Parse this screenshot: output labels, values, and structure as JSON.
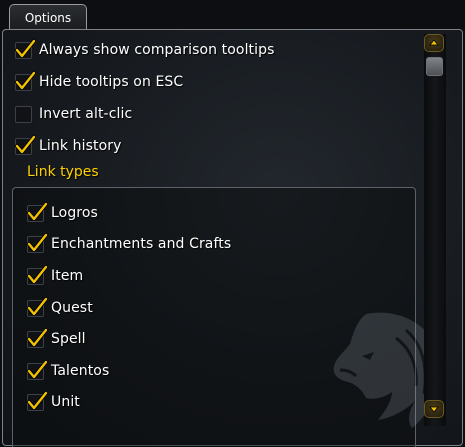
{
  "tab": {
    "label": "Options"
  },
  "options": [
    {
      "label": "Always show comparison tooltips",
      "checked": true
    },
    {
      "label": "Hide tooltips on ESC",
      "checked": true
    },
    {
      "label": "Invert alt-clic",
      "checked": false
    },
    {
      "label": "Link history",
      "checked": true
    }
  ],
  "link_types": {
    "title": "Link types",
    "items": [
      {
        "label": "Logros",
        "checked": true
      },
      {
        "label": "Enchantments and Crafts",
        "checked": true
      },
      {
        "label": "Item",
        "checked": true
      },
      {
        "label": "Quest",
        "checked": true
      },
      {
        "label": "Spell",
        "checked": true
      },
      {
        "label": "Talentos",
        "checked": true
      },
      {
        "label": "Unit",
        "checked": true
      }
    ]
  },
  "colors": {
    "accent_gold": "#ffd200",
    "text": "#ffffff",
    "panel_border": "#7e8186"
  },
  "icons": {
    "check": "checkmark-icon",
    "scroll_up": "scroll-up-icon",
    "scroll_down": "scroll-down-icon",
    "watermark": "lion-head-icon"
  }
}
